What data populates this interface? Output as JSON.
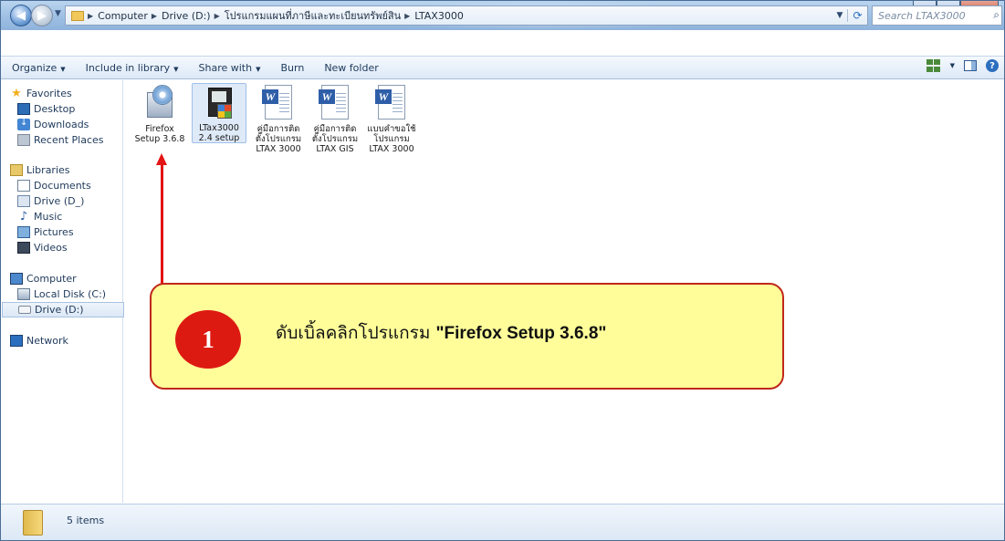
{
  "window": {
    "minimize_glyph": "–",
    "maximize_glyph": "▫",
    "close_glyph": "x"
  },
  "address": {
    "crumbs": [
      "Computer",
      "Drive (D:)",
      "โปรแกรมแผนที่ภาษีและทะเบียนทรัพย์สิน",
      "LTAX3000"
    ],
    "separator": "▶"
  },
  "search": {
    "placeholder": "Search LTAX3000"
  },
  "toolbar": {
    "organize": "Organize",
    "include_in_library": "Include in library",
    "share_with": "Share with",
    "burn": "Burn",
    "new_folder": "New folder"
  },
  "nav": {
    "favorites": "Favorites",
    "desktop": "Desktop",
    "downloads": "Downloads",
    "recent_places": "Recent Places",
    "libraries": "Libraries",
    "documents": "Documents",
    "drive_lib": "Drive (D_)",
    "music": "Music",
    "pictures": "Pictures",
    "videos": "Videos",
    "computer": "Computer",
    "local_disk": "Local Disk (C:)",
    "drive_d": "Drive (D:)",
    "network": "Network"
  },
  "files": [
    {
      "line1": "Firefox",
      "line2": "Setup 3.6.8",
      "line3": "",
      "icon": "installer-disc-icon"
    },
    {
      "line1": "LTax3000",
      "line2": "2.4 setup",
      "line3": "",
      "icon": "setup-package-icon"
    },
    {
      "line1": "คู่มือการติด",
      "line2": "ตั้งโปรแกรม",
      "line3": "LTAX 3000",
      "icon": "word-document-icon"
    },
    {
      "line1": "คู่มือการติด",
      "line2": "ตั้งโปรแกรม",
      "line3": "LTAX GIS",
      "icon": "word-document-icon"
    },
    {
      "line1": "แบบคำขอใช้",
      "line2": "โปรแกรม",
      "line3": "LTAX 3000",
      "icon": "word-document-icon"
    }
  ],
  "callout": {
    "step": "1",
    "text": "ดับเบิ้ลคลิกโปรแกรม ",
    "emphasis": "\"Firefox Setup 3.6.8\""
  },
  "colors": {
    "callout_fill": "#fefd9a",
    "callout_border": "#c0281b",
    "badge": "#dd1a12",
    "arrow": "#e31414"
  },
  "status": {
    "count": "5 items"
  }
}
